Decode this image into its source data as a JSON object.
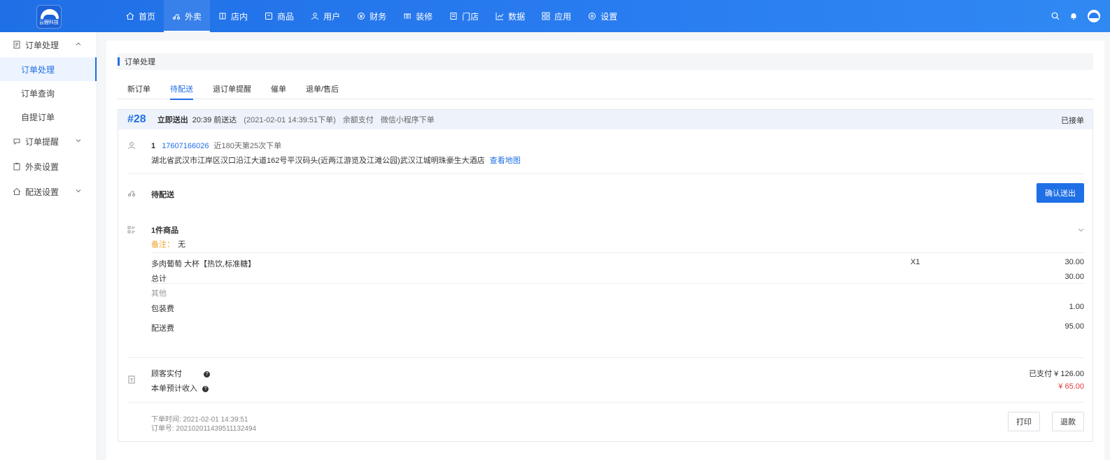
{
  "brand": {
    "logo_text": "云鲤科技"
  },
  "nav": [
    {
      "label": "首页",
      "icon": "home-icon"
    },
    {
      "label": "外卖",
      "icon": "takeout-icon",
      "active": true
    },
    {
      "label": "店内",
      "icon": "store-inside-icon"
    },
    {
      "label": "商品",
      "icon": "goods-icon"
    },
    {
      "label": "用户",
      "icon": "user-icon"
    },
    {
      "label": "财务",
      "icon": "finance-icon"
    },
    {
      "label": "装修",
      "icon": "decoration-icon"
    },
    {
      "label": "门店",
      "icon": "shop-icon"
    },
    {
      "label": "数据",
      "icon": "chart-icon"
    },
    {
      "label": "应用",
      "icon": "apps-icon"
    },
    {
      "label": "设置",
      "icon": "settings-icon"
    }
  ],
  "sidebar": {
    "groups": [
      {
        "label": "订单处理",
        "items": [
          "订单处理",
          "订单查询",
          "自提订单"
        ],
        "expanded": true
      },
      {
        "label": "订单提醒",
        "expanded": false
      },
      {
        "label": "外卖设置"
      },
      {
        "label": "配送设置",
        "expanded": false
      }
    ],
    "active_item": "订单处理"
  },
  "page": {
    "title": "订单处理",
    "tabs": [
      "新订单",
      "待配送",
      "退订单提醒",
      "催单",
      "退单/售后"
    ],
    "active_tab": "待配送"
  },
  "order": {
    "number": "#28",
    "delivery_type": "立即送出",
    "deliver_time": "20:39 前送达",
    "placed_time": "(2021-02-01 14:39:51下单)",
    "payment": "余额支付",
    "channel": "微信小程序下单",
    "status_right": "已接单",
    "customer": {
      "index": "1",
      "phone": "17607166026",
      "visits": "近180天第25次下单",
      "address": "湖北省武汉市江岸区汉口沿江大道162号平汉码头(近两江游览及江滩公园)武汉江城明珠豪生大酒店",
      "map_link": "查看地图"
    },
    "status_label": "待配送",
    "confirm_button": "确认送出",
    "goods": {
      "title": "1件商品",
      "remark_label": "备注：",
      "remark_value": "无",
      "items": [
        {
          "name": "多肉葡萄 大杯【热饮,标准糖】",
          "qty": "X1",
          "amount": "30.00"
        }
      ],
      "subtotal_label": "总计",
      "subtotal": "30.00",
      "other_label": "其他",
      "packing_label": "包装费",
      "packing": "1.00",
      "delivery_label": "配送费",
      "delivery": "95.00"
    },
    "payment_info": {
      "paid_label": "顾客实付",
      "paid_value": "已支付 ¥ 126.00",
      "income_label": "本单预计收入",
      "income_value": "¥ 65.00",
      "q_mark": "?"
    },
    "footer": {
      "order_time": "下单时间: 2021-02-01 14:39:51",
      "order_no": "订单号: 202102011439511132494",
      "print_button": "打印",
      "refund_button": "退款"
    }
  },
  "colors": {
    "primary": "#1f6fe6",
    "alert": "#e23a3a",
    "remark": "#f0a020"
  }
}
